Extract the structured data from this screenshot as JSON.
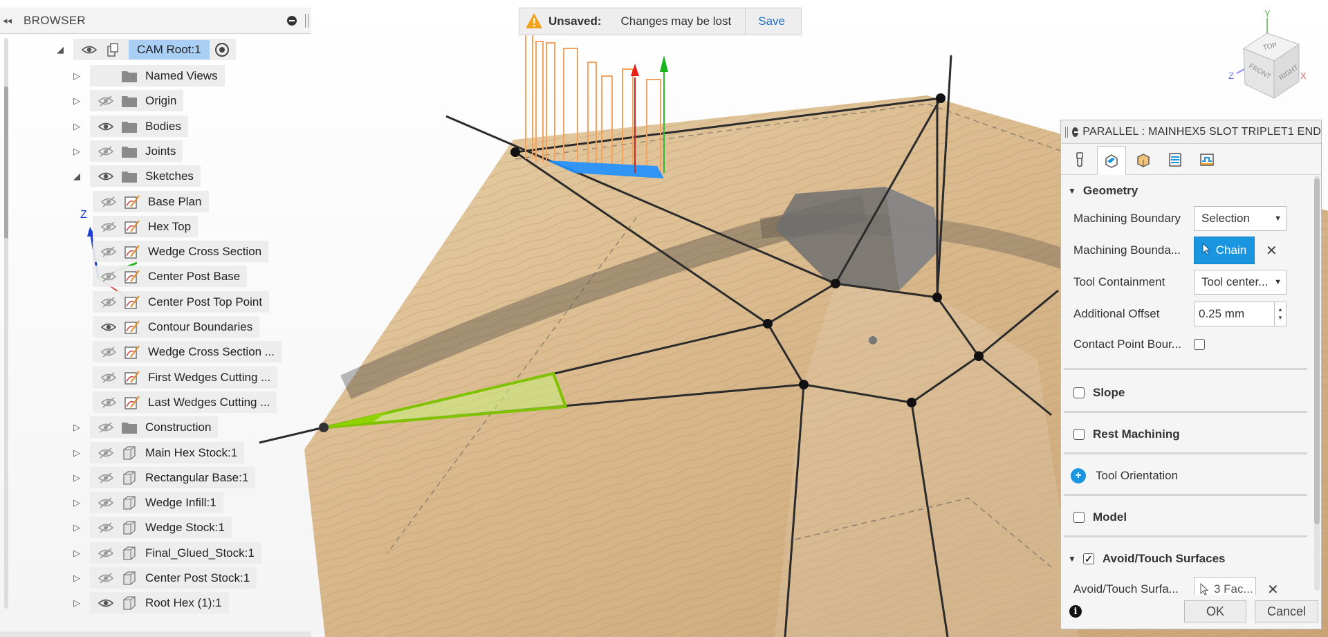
{
  "browser": {
    "title": "BROWSER",
    "root": "CAM Root:1",
    "items": [
      {
        "label": "Named Views",
        "visible": "none",
        "icon": "folder-icon",
        "expand": "collapsed"
      },
      {
        "label": "Origin",
        "visible": "hidden",
        "icon": "folder-icon",
        "expand": "collapsed"
      },
      {
        "label": "Bodies",
        "visible": "shown",
        "icon": "folder-icon",
        "expand": "collapsed"
      },
      {
        "label": "Joints",
        "visible": "hidden",
        "icon": "folder-icon",
        "expand": "collapsed"
      },
      {
        "label": "Sketches",
        "visible": "shown",
        "icon": "folder-icon",
        "expand": "expanded"
      },
      {
        "label": "Base Plan",
        "visible": "hidden",
        "icon": "sketch-icon",
        "expand": "leaf"
      },
      {
        "label": "Hex Top",
        "visible": "hidden",
        "icon": "sketch-icon",
        "expand": "leaf"
      },
      {
        "label": "Wedge Cross Section",
        "visible": "hidden",
        "icon": "sketch-icon",
        "expand": "leaf"
      },
      {
        "label": "Center Post Base",
        "visible": "hidden",
        "icon": "sketch-icon",
        "expand": "leaf"
      },
      {
        "label": "Center Post Top Point",
        "visible": "hidden",
        "icon": "sketch-icon",
        "expand": "leaf"
      },
      {
        "label": "Contour Boundaries",
        "visible": "shown",
        "icon": "sketch-icon",
        "expand": "leaf"
      },
      {
        "label": "Wedge Cross Section ...",
        "visible": "hidden",
        "icon": "sketch-icon",
        "expand": "leaf"
      },
      {
        "label": "First Wedges Cutting ...",
        "visible": "hidden",
        "icon": "sketch-icon",
        "expand": "leaf"
      },
      {
        "label": "Last Wedges Cutting ...",
        "visible": "hidden",
        "icon": "sketch-icon",
        "expand": "leaf"
      },
      {
        "label": "Construction",
        "visible": "hidden",
        "icon": "folder-icon",
        "expand": "collapsed"
      },
      {
        "label": "Main Hex Stock:1",
        "visible": "hidden",
        "icon": "body-icon",
        "expand": "collapsed"
      },
      {
        "label": "Rectangular Base:1",
        "visible": "hidden",
        "icon": "body-icon",
        "expand": "collapsed"
      },
      {
        "label": "Wedge Infill:1",
        "visible": "hidden",
        "icon": "body-icon",
        "expand": "collapsed"
      },
      {
        "label": "Wedge Stock:1",
        "visible": "hidden",
        "icon": "body-icon",
        "expand": "collapsed"
      },
      {
        "label": "Final_Glued_Stock:1",
        "visible": "hidden",
        "icon": "body-icon",
        "expand": "collapsed"
      },
      {
        "label": "Center Post Stock:1",
        "visible": "hidden",
        "icon": "body-icon",
        "expand": "collapsed"
      },
      {
        "label": "Root Hex (1):1",
        "visible": "shown",
        "icon": "body-icon",
        "expand": "collapsed"
      }
    ]
  },
  "unsaved": {
    "label": "Unsaved:",
    "message": "Changes may be lost",
    "save": "Save"
  },
  "viewcube": {
    "top": "TOP",
    "front": "FRONT",
    "right": "RIGHT",
    "axis_y": "Y",
    "axis_z": "Z",
    "axis_x": "X"
  },
  "triad": {
    "z": "Z"
  },
  "dialog": {
    "title": "PARALLEL : MAINHEX5 SLOT TRIPLET1 END",
    "tabs": [
      "tool-tab-icon",
      "geometry-tab-icon",
      "heights-tab-icon",
      "passes-tab-icon",
      "linking-tab-icon"
    ],
    "geometry": {
      "heading": "Geometry",
      "machining_boundary_label": "Machining Boundary",
      "machining_boundary_value": "Selection",
      "machining_boundary_sel_label": "Machining Bounda...",
      "chain_label": "Chain",
      "tool_containment_label": "Tool Containment",
      "tool_containment_value": "Tool center...",
      "additional_offset_label": "Additional Offset",
      "additional_offset_value": "0.25 mm",
      "contact_point_label": "Contact Point Bour..."
    },
    "slope": "Slope",
    "rest_machining": "Rest Machining",
    "tool_orientation": "Tool Orientation",
    "model": "Model",
    "avoid": {
      "heading": "Avoid/Touch Surfaces",
      "surfaces_label": "Avoid/Touch Surfa...",
      "surfaces_value": "3 Fac..."
    },
    "ok": "OK",
    "cancel": "Cancel"
  },
  "colors": {
    "accent": "#1a95df",
    "selection": "#a9cff5",
    "wood": "#dcc09a",
    "highlight_green": "#8fd400",
    "toolpath_orange": "#f5a25c"
  }
}
